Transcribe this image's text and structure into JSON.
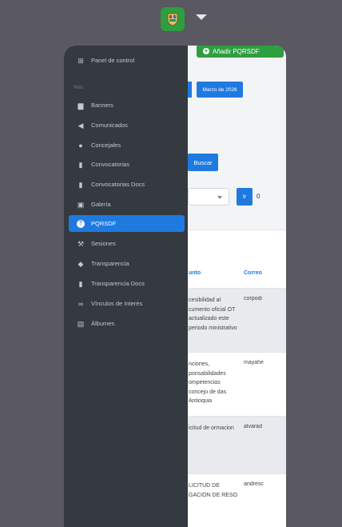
{
  "topbar": {
    "logo": "crest-logo",
    "menu_caret": "caret-down-icon"
  },
  "page": {
    "add_button_label": "Añadir PQRSDF",
    "date_chip_label": "Marzo de 2026",
    "search_button_label": "Buscar",
    "go_button_label": "Ir",
    "result_count": "0",
    "table_headers": [
      "unto",
      "Correo"
    ],
    "rows": [
      {
        "asunto": "cesibilidad al cumento oficial OT actualizado este periodo ministrativo",
        "correo": "corpodi",
        "shaded": true
      },
      {
        "asunto": "nciones, ponsabilidades ompetencias concejo de das Antioquia",
        "correo": "mayahe",
        "shaded": false
      },
      {
        "asunto": "icitud de ormacion",
        "correo": "alvarad",
        "shaded": true
      },
      {
        "asunto": "LICITUD DE GACION DE RESO",
        "correo": "andresc",
        "shaded": false
      }
    ]
  },
  "sidebar": {
    "dashboard_label": "Panel de control",
    "section_label": "Web",
    "items": [
      {
        "label": "Banners",
        "icon": "image-icon",
        "glyph": "▆"
      },
      {
        "label": "Comunicados",
        "icon": "megaphone-icon",
        "glyph": "◀"
      },
      {
        "label": "Concejales",
        "icon": "user-icon",
        "glyph": "●"
      },
      {
        "label": "Convocatorias",
        "icon": "clipboard-icon",
        "glyph": "▮"
      },
      {
        "label": "Convocatorias Docs",
        "icon": "file-icon",
        "glyph": "▮"
      },
      {
        "label": "Galería",
        "icon": "gallery-icon",
        "glyph": "▣"
      },
      {
        "label": "PQRSDF",
        "icon": "question-circle-icon",
        "glyph": "?",
        "active": true
      },
      {
        "label": "Sesiones",
        "icon": "gavel-icon",
        "glyph": "⚒"
      },
      {
        "label": "Transparencia",
        "icon": "tag-icon",
        "glyph": "◆"
      },
      {
        "label": "Transparencia Docs",
        "icon": "file-icon",
        "glyph": "▮"
      },
      {
        "label": "Vínculos de Interés",
        "icon": "link-icon",
        "glyph": "∞"
      },
      {
        "label": "Álbumes",
        "icon": "images-icon",
        "glyph": "▤"
      }
    ]
  },
  "colors": {
    "accent": "#1f7ae0",
    "success": "#2e9e3f",
    "sidebar": "#343a40",
    "backdrop": "#5a5860"
  }
}
